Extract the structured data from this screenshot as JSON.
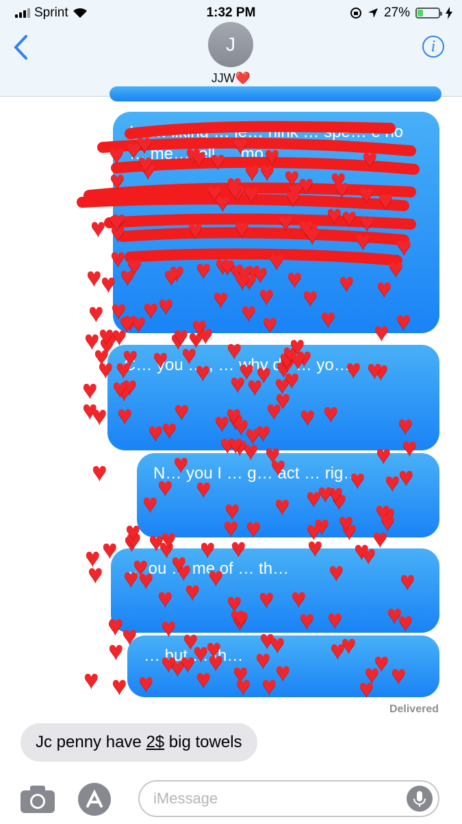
{
  "status_bar": {
    "carrier": "Sprint",
    "time": "1:32 PM",
    "battery": "27%",
    "battery_level": 0.27
  },
  "header": {
    "avatar_initial": "J",
    "contact_name": "JJW❤️",
    "info_label": "i"
  },
  "messages": {
    "sent": [
      {
        "text": "I w… liking … je… hink … spe… e no … me… tell … mo…"
      },
      {
        "text": "C… you … , … why do … yo…"
      },
      {
        "text": "N… you I … g… act … rig…"
      },
      {
        "text": "… ou … me of … th…"
      },
      {
        "text": "… but … th…"
      }
    ],
    "delivered_label": "Delivered",
    "received": {
      "text_before": "Jc penny have ",
      "text_link": "2$",
      "text_after": " big towels"
    }
  },
  "input_bar": {
    "placeholder": "iMessage"
  },
  "colors": {
    "bubble_top": "#48b0f7",
    "bubble_bottom": "#1a83f6",
    "scribble": "#f21c1c",
    "heart": "#f2262a",
    "received_bubble": "#e5e5ea"
  }
}
